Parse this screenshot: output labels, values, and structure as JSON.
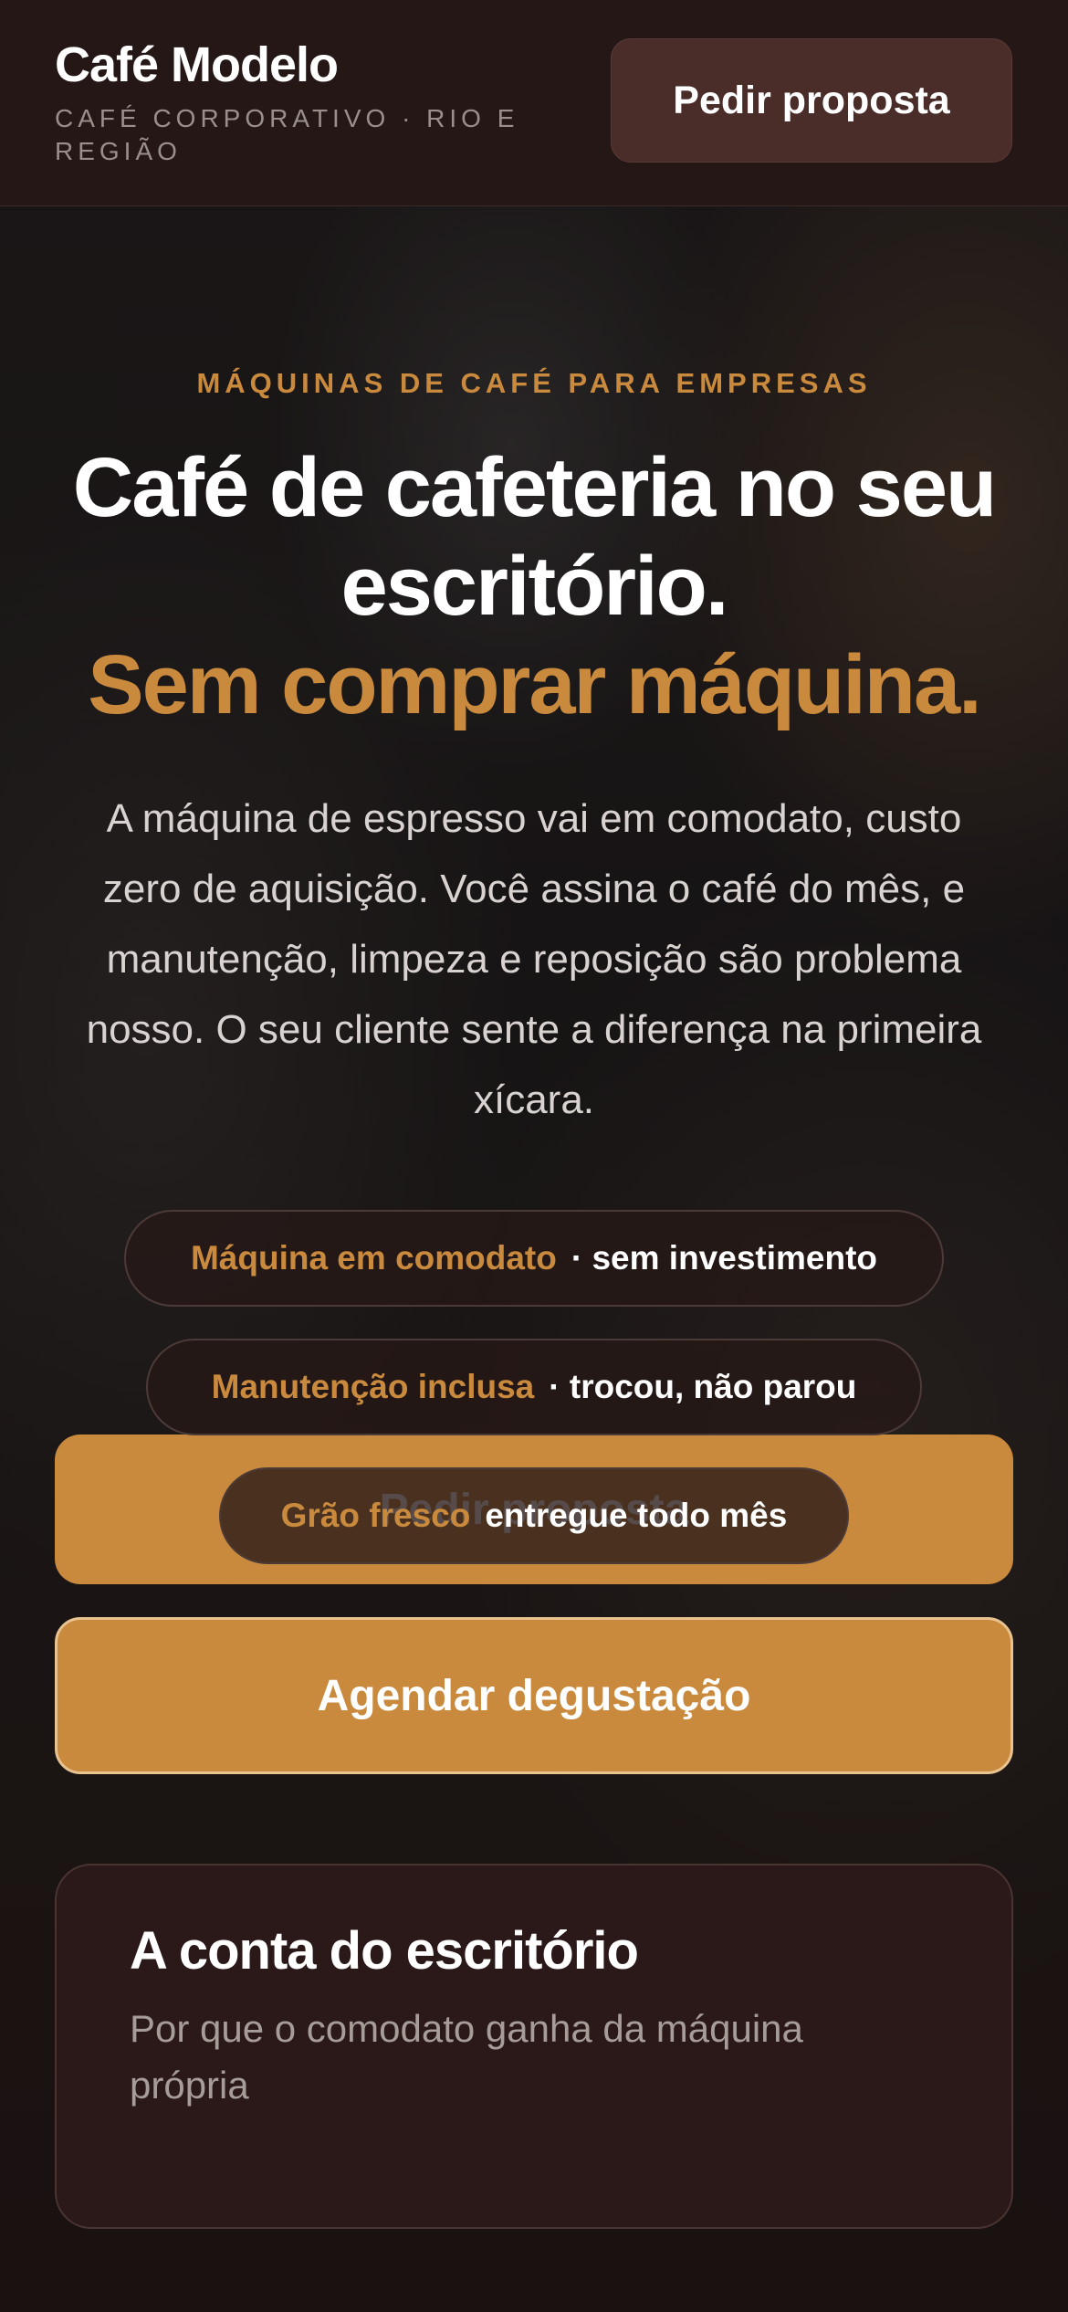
{
  "header": {
    "brand_name": "Café Modelo",
    "tagline": "CAFÉ CORPORATIVO · RIO E REGIÃO",
    "cta_label": "Pedir proposta"
  },
  "hero": {
    "eyebrow": "MÁQUINAS DE CAFÉ PARA EMPRESAS",
    "headline_main": "Café de cafeteria no seu escritório.",
    "headline_accent": "Sem comprar máquina.",
    "lead": "A máquina de espresso vai em comodato, custo zero de aquisição. Você assina o café do mês, e manutenção, limpeza e reposição são problema nosso. O seu cliente sente a diferença na primeira xícara.",
    "chips": [
      {
        "title": "Máquina em comodato",
        "detail": "· sem investimento"
      },
      {
        "title": "Manutenção inclusa",
        "detail": "· trocou, não parou"
      },
      {
        "title": "Grão fresco",
        "detail": "entregue todo mês"
      }
    ],
    "primary_cta": "Pedir proposta",
    "secondary_cta": "Agendar degustação"
  },
  "card": {
    "title": "A conta do escritório",
    "subtitle": "Por que o comodato ganha da máquina própria"
  },
  "colors": {
    "accent": "#c98a3e",
    "header_bg": "#241716",
    "header_button_bg": "#4a2c29",
    "card_bg": "#2a1918"
  }
}
